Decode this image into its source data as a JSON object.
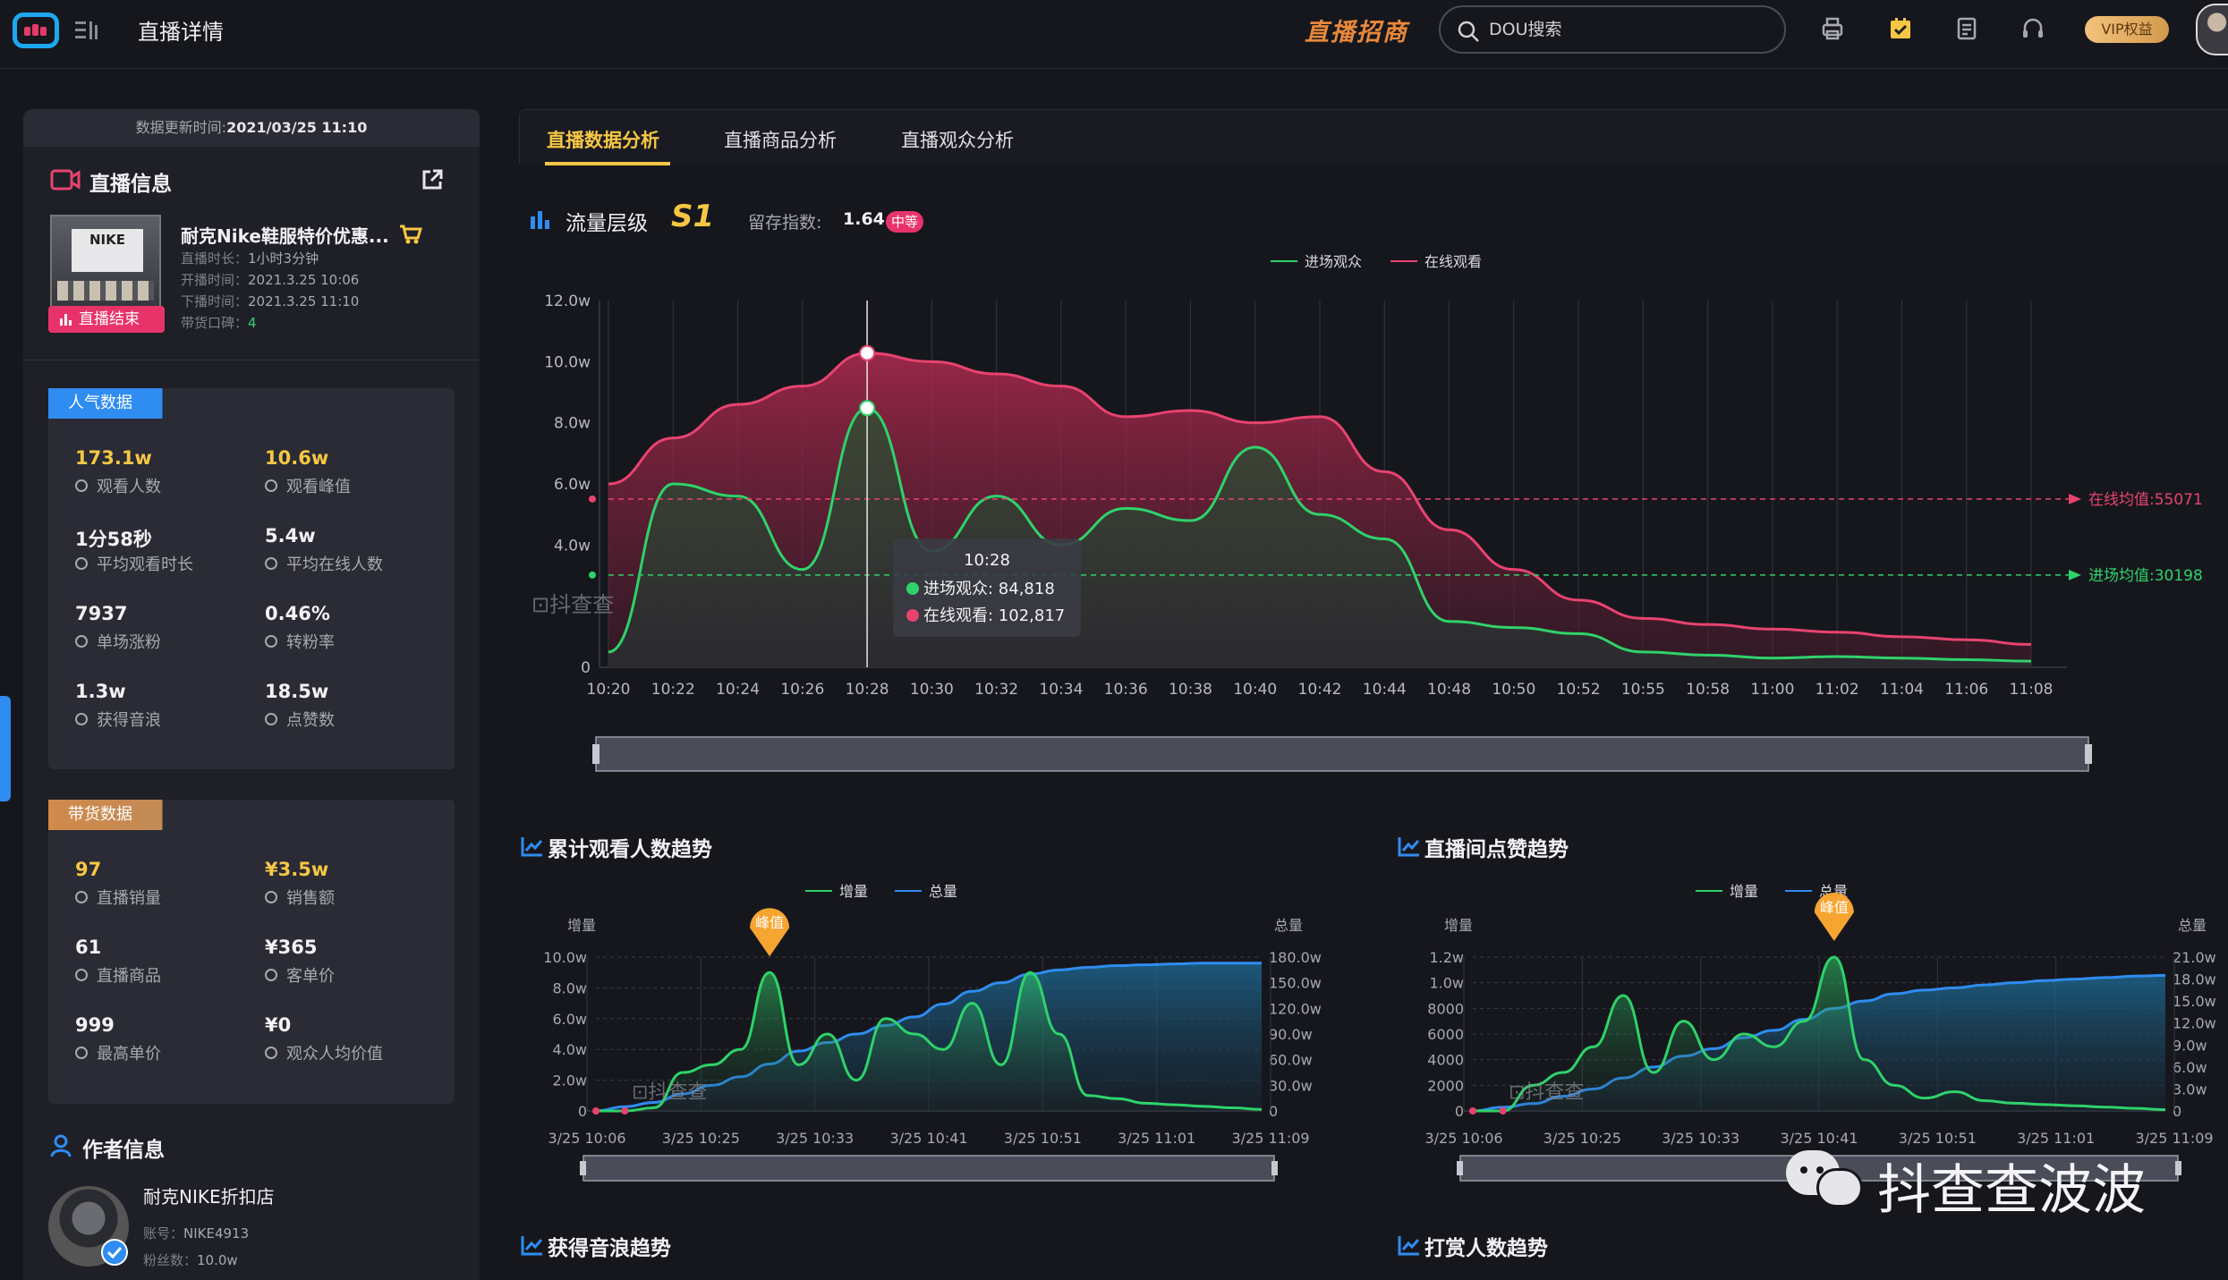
{
  "header": {
    "title": "直播详情",
    "recruit_label": "直播招商",
    "search_placeholder": "DOU搜索",
    "vip_label": "VIP权益"
  },
  "left": {
    "update_label": "数据更新时间:",
    "update_time": "2021/03/25 11:10",
    "live_info_title": "直播信息",
    "product_name": "耐克Nike鞋服特价优惠...",
    "cover_text": "NIKE",
    "end_badge": "直播结束",
    "duration_label": "直播时长：",
    "duration": "1小时3分钟",
    "start_label": "开播时间：",
    "start_time": "2021.3.25 10:06",
    "end_label": "下播时间：",
    "end_time": "2021.3.25 11:10",
    "reputation_label": "带货口碑：",
    "reputation": "4",
    "popularity_title": "人气数据",
    "popularity": [
      {
        "value": "173.1w",
        "label": "观看人数",
        "gold": true
      },
      {
        "value": "10.6w",
        "label": "观看峰值",
        "gold": true
      },
      {
        "value": "1分58秒",
        "label": "平均观看时长",
        "gold": false
      },
      {
        "value": "5.4w",
        "label": "平均在线人数",
        "gold": false
      },
      {
        "value": "7937",
        "label": "单场涨粉",
        "gold": false
      },
      {
        "value": "0.46%",
        "label": "转粉率",
        "gold": false
      },
      {
        "value": "1.3w",
        "label": "获得音浪",
        "gold": false
      },
      {
        "value": "18.5w",
        "label": "点赞数",
        "gold": false
      }
    ],
    "goods_title": "带货数据",
    "goods": [
      {
        "value": "97",
        "label": "直播销量",
        "gold": true
      },
      {
        "value": "¥3.5w",
        "label": "销售额",
        "gold": true
      },
      {
        "value": "61",
        "label": "直播商品",
        "gold": false
      },
      {
        "value": "¥365",
        "label": "客单价",
        "gold": false
      },
      {
        "value": "999",
        "label": "最高单价",
        "gold": false
      },
      {
        "value": "¥0",
        "label": "观众人均价值",
        "gold": false
      }
    ],
    "author_title": "作者信息",
    "author_name": "耐克NIKE折扣店",
    "account_label": "账号：",
    "account": "NIKE4913",
    "fans_label": "粉丝数：",
    "fans": "10.0w"
  },
  "tabs": [
    "直播数据分析",
    "直播商品分析",
    "直播观众分析"
  ],
  "traffic": {
    "title": "流量层级",
    "level": "S1",
    "retention_label": "留存指数:",
    "retention_value": "1.64",
    "retention_badge": "中等"
  },
  "watermark": "抖查查",
  "footer_watermark": "抖查查波波",
  "chart_data": [
    {
      "type": "area",
      "legend": [
        "进场观众",
        "在线观看"
      ],
      "y_ticks": [
        "12.0w",
        "10.0w",
        "8.0w",
        "6.0w",
        "4.0w",
        "0"
      ],
      "x": [
        "10:20",
        "10:22",
        "10:24",
        "10:26",
        "10:28",
        "10:30",
        "10:32",
        "10:34",
        "10:36",
        "10:38",
        "10:40",
        "10:42",
        "10:44",
        "10:48",
        "10:50",
        "10:52",
        "10:55",
        "10:58",
        "11:00",
        "11:02",
        "11:04",
        "11:06",
        "11:08"
      ],
      "ylim": [
        0,
        120000
      ],
      "series": [
        {
          "name": "在线观看",
          "color": "#e8436f",
          "values": [
            60000,
            75000,
            86000,
            92000,
            102817,
            100000,
            96000,
            92000,
            82000,
            84000,
            80000,
            82000,
            64000,
            45000,
            32000,
            22000,
            16000,
            14000,
            12500,
            11500,
            10000,
            9000,
            7500
          ]
        },
        {
          "name": "进场观众",
          "color": "#2fd26a",
          "values": [
            5000,
            60000,
            56000,
            32000,
            84818,
            38000,
            56000,
            40000,
            52000,
            48000,
            72000,
            50000,
            42000,
            15000,
            13000,
            11000,
            5000,
            4000,
            3000,
            3500,
            3000,
            2500,
            2000
          ]
        }
      ],
      "mean_lines": [
        {
          "label": "在线均值:55071",
          "value": 55071,
          "color": "#e8436f"
        },
        {
          "label": "进场均值:30198",
          "value": 30198,
          "color": "#2fd26a"
        }
      ],
      "tooltip": {
        "time": "10:28",
        "rows": [
          "进场观众: 84,818",
          "在线观看: 102,817"
        ]
      }
    },
    {
      "type": "line",
      "title": "累计观看人数趋势",
      "legend": [
        "增量",
        "总量"
      ],
      "y_left_title": "增量",
      "y_right_title": "总量",
      "y_left_ticks": [
        "10.0w",
        "8.0w",
        "6.0w",
        "4.0w",
        "2.0w",
        "0"
      ],
      "y_right_ticks": [
        "180.0w",
        "150.0w",
        "120.0w",
        "90.0w",
        "60.0w",
        "30.0w",
        "0"
      ],
      "x_ticks": [
        "3/25 10:06",
        "3/25 10:25",
        "3/25 10:33",
        "3/25 10:41",
        "3/25 10:51",
        "3/25 11:01",
        "3/25 11:09"
      ],
      "peak_label": "峰值",
      "series": [
        {
          "name": "增量",
          "color": "#2fd26a",
          "values": [
            0,
            0,
            2000,
            25000,
            30000,
            40000,
            90000,
            30000,
            50000,
            20000,
            60000,
            50000,
            40000,
            70000,
            30000,
            90000,
            50000,
            10000,
            8000,
            5000,
            4000,
            3000,
            2000,
            1000
          ]
        },
        {
          "name": "总量",
          "color": "#2f8cf0",
          "values": [
            0,
            5,
            10,
            20,
            30,
            40,
            55,
            70,
            80,
            90,
            100,
            110,
            125,
            140,
            150,
            160,
            165,
            168,
            170,
            171,
            172,
            173,
            173,
            173
          ]
        }
      ]
    },
    {
      "type": "line",
      "title": "直播间点赞趋势",
      "legend": [
        "增量",
        "总量"
      ],
      "y_left_title": "增量",
      "y_right_title": "总量",
      "y_left_ticks": [
        "1.2w",
        "1.0w",
        "8000",
        "6000",
        "4000",
        "2000",
        "0"
      ],
      "y_right_ticks": [
        "21.0w",
        "18.0w",
        "15.0w",
        "12.0w",
        "9.0w",
        "6.0w",
        "3.0w",
        "0"
      ],
      "x_ticks": [
        "3/25 10:06",
        "3/25 10:25",
        "3/25 10:33",
        "3/25 10:41",
        "3/25 10:51",
        "3/25 11:01",
        "3/25 11:09"
      ],
      "peak_label": "峰值",
      "series": [
        {
          "name": "增量",
          "color": "#2fd26a",
          "values": [
            0,
            0,
            2000,
            3000,
            5000,
            9000,
            3000,
            7000,
            4000,
            6000,
            5000,
            7000,
            12000,
            4000,
            2000,
            1000,
            1500,
            800,
            600,
            500,
            400,
            300,
            200,
            100
          ]
        },
        {
          "name": "总量",
          "color": "#2f8cf0",
          "values": [
            0,
            5,
            10,
            20,
            30,
            45,
            60,
            75,
            85,
            100,
            110,
            125,
            140,
            150,
            160,
            165,
            168,
            172,
            175,
            178,
            180,
            182,
            184,
            185
          ]
        }
      ]
    }
  ],
  "bottom_titles": [
    "获得音浪趋势",
    "打赏人数趋势"
  ]
}
